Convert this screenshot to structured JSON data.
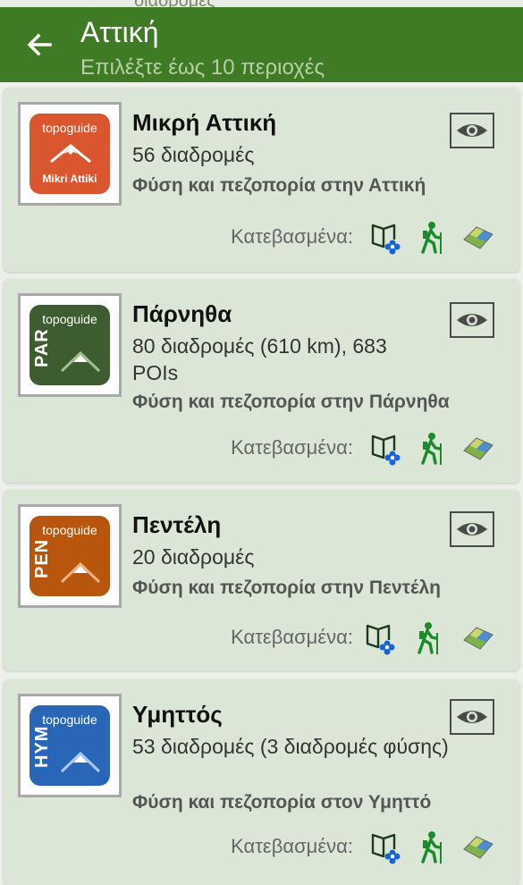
{
  "appbar": {
    "title": "Αττική",
    "subtitle": "Επιλέξτε έως 10 περιοχές"
  },
  "downloaded_label": "Κατεβασμένα:",
  "items": [
    {
      "name": "Μικρή Αττική",
      "count": "56 διαδρομές",
      "desc": "Φύση και πεζοπορία στην Αττική",
      "logo_brand": "topoguide",
      "logo_code": "",
      "logo_caption": "Mikri Attiki",
      "logo_color": "#d9562f"
    },
    {
      "name": "Πάρνηθα",
      "count": "80 διαδρομές (610 km), 683 POIs",
      "desc": "Φύση και πεζοπορία στην Πάρνηθα",
      "logo_brand": "topoguide",
      "logo_code": "PAR",
      "logo_caption": "",
      "logo_color": "#3d5c30"
    },
    {
      "name": "Πεντέλη",
      "count": "20 διαδρομές",
      "desc": "Φύση και πεζοπορία στην Πεντέλη",
      "logo_brand": "topoguide",
      "logo_code": "PEN",
      "logo_caption": "",
      "logo_color": "#b8560d"
    },
    {
      "name": "Υμηττός",
      "count": "53 διαδρομές (3 διαδρομές φύσης)",
      "desc": "Φύση και πεζοπορία στον Υμηττό",
      "logo_brand": "topoguide",
      "logo_code": "HYM",
      "logo_caption": "",
      "logo_color": "#2a66b8"
    }
  ],
  "icons": {
    "back": "arrow-left-icon",
    "eye": "eye-icon",
    "guide": "book-flower-icon",
    "hiker": "hiker-icon",
    "map": "map-icon"
  },
  "colors": {
    "appbar": "#3f7a24",
    "card": "#dce6d7",
    "hiker": "#1a8a2a",
    "flower": "#1763d8"
  }
}
